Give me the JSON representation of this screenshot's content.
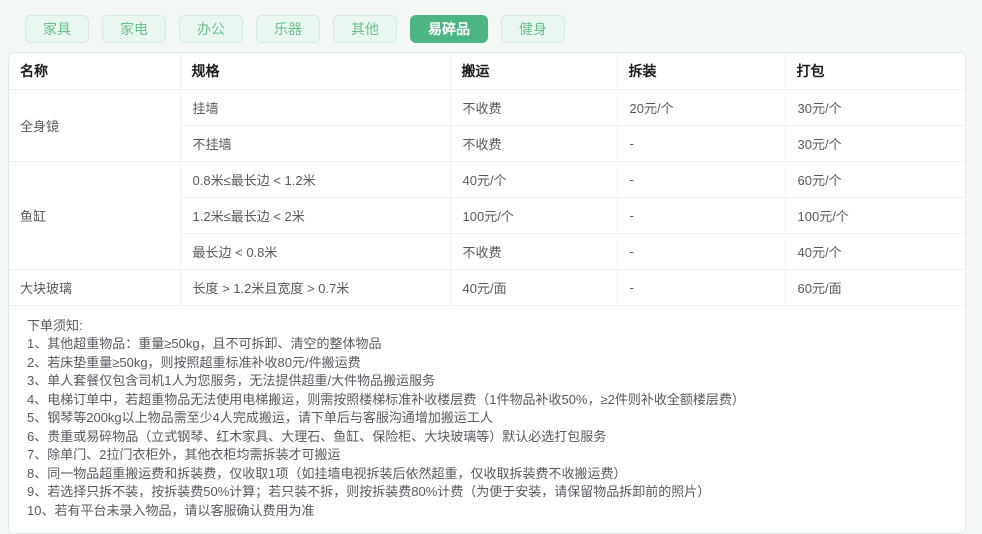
{
  "colors": {
    "accent_green": "#4db584",
    "tab_inactive_bg": "#eaf7f0",
    "tab_inactive_text": "#68bf8e",
    "table_border": "#ecf3f0"
  },
  "tabs": [
    {
      "label": "家具",
      "active": false
    },
    {
      "label": "家电",
      "active": false
    },
    {
      "label": "办公",
      "active": false
    },
    {
      "label": "乐器",
      "active": false
    },
    {
      "label": "其他",
      "active": false
    },
    {
      "label": "易碎品",
      "active": true
    },
    {
      "label": "健身",
      "active": false
    }
  ],
  "table": {
    "headers": [
      "名称",
      "规格",
      "搬运",
      "拆装",
      "打包"
    ],
    "groups": [
      {
        "name": "全身镜",
        "rows": [
          {
            "spec": "挂墙",
            "move": "不收费",
            "disassemble": "20元/个",
            "pack": "30元/个"
          },
          {
            "spec": "不挂墙",
            "move": "不收费",
            "disassemble": "-",
            "pack": "30元/个"
          }
        ]
      },
      {
        "name": "鱼缸",
        "rows": [
          {
            "spec": "0.8米≤最长边 < 1.2米",
            "move": "40元/个",
            "disassemble": "-",
            "pack": "60元/个"
          },
          {
            "spec": "1.2米≤最长边 < 2米",
            "move": "100元/个",
            "disassemble": "-",
            "pack": "100元/个"
          },
          {
            "spec": "最长边 < 0.8米",
            "move": "不收费",
            "disassemble": "-",
            "pack": "40元/个"
          }
        ]
      },
      {
        "name": "大块玻璃",
        "rows": [
          {
            "spec": "长度 > 1.2米且宽度 > 0.7米",
            "move": "40元/面",
            "disassemble": "-",
            "pack": "60元/面"
          }
        ]
      }
    ]
  },
  "notes": {
    "title": "下单须知:",
    "items": [
      "1、其他超重物品：重量≥50kg，且不可拆卸、清空的整体物品",
      "2、若床垫重量≥50kg，则按照超重标准补收80元/件搬运费",
      "3、单人套餐仅包含司机1人为您服务，无法提供超重/大件物品搬运服务",
      "4、电梯订单中，若超重物品无法使用电梯搬运，则需按照楼梯标准补收楼层费（1件物品补收50%，≥2件则补收全额楼层费）",
      "5、钢琴等200kg以上物品需至少4人完成搬运，请下单后与客服沟通增加搬运工人",
      "6、贵重或易碎物品（立式钢琴、红木家具、大理石、鱼缸、保险柜、大块玻璃等）默认必选打包服务",
      "7、除单门、2拉门衣柜外，其他衣柜均需拆装才可搬运",
      "8、同一物品超重搬运费和拆装费，仅收取1项（如挂墙电视拆装后依然超重，仅收取拆装费不收搬运费）",
      "9、若选择只拆不装，按拆装费50%计算；若只装不拆，则按拆装费80%计费（为便于安装，请保留物品拆卸前的照片）",
      "10、若有平台未录入物品，请以客服确认费用为准"
    ]
  }
}
